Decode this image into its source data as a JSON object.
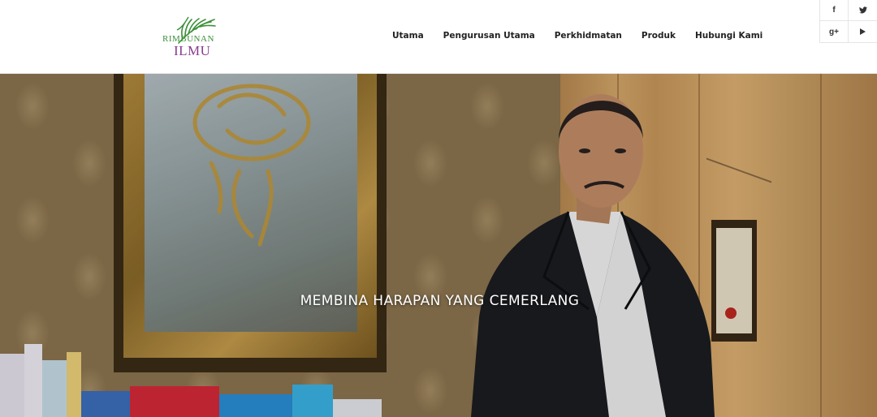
{
  "logo": {
    "line1": "RIMBUNAN",
    "line2": "ILMU",
    "icon": "palm-leaf-icon",
    "colors": {
      "green": "#3d8f3a",
      "purple": "#8a3b8f"
    }
  },
  "nav": {
    "items": [
      {
        "label": "Utama"
      },
      {
        "label": "Pengurusan Utama"
      },
      {
        "label": "Perkhidmatan"
      },
      {
        "label": "Produk"
      },
      {
        "label": "Hubungi Kami"
      }
    ]
  },
  "social": {
    "facebook": {
      "glyph": "f",
      "icon": "facebook-icon"
    },
    "twitter": {
      "glyph": "t",
      "icon": "twitter-icon"
    },
    "googleplus": {
      "glyph": "g+",
      "icon": "google-plus-icon"
    },
    "youtube": {
      "glyph": "▶",
      "icon": "youtube-icon"
    }
  },
  "hero": {
    "title": "MEMBINA HARAPAN YANG CEMERLANG"
  }
}
